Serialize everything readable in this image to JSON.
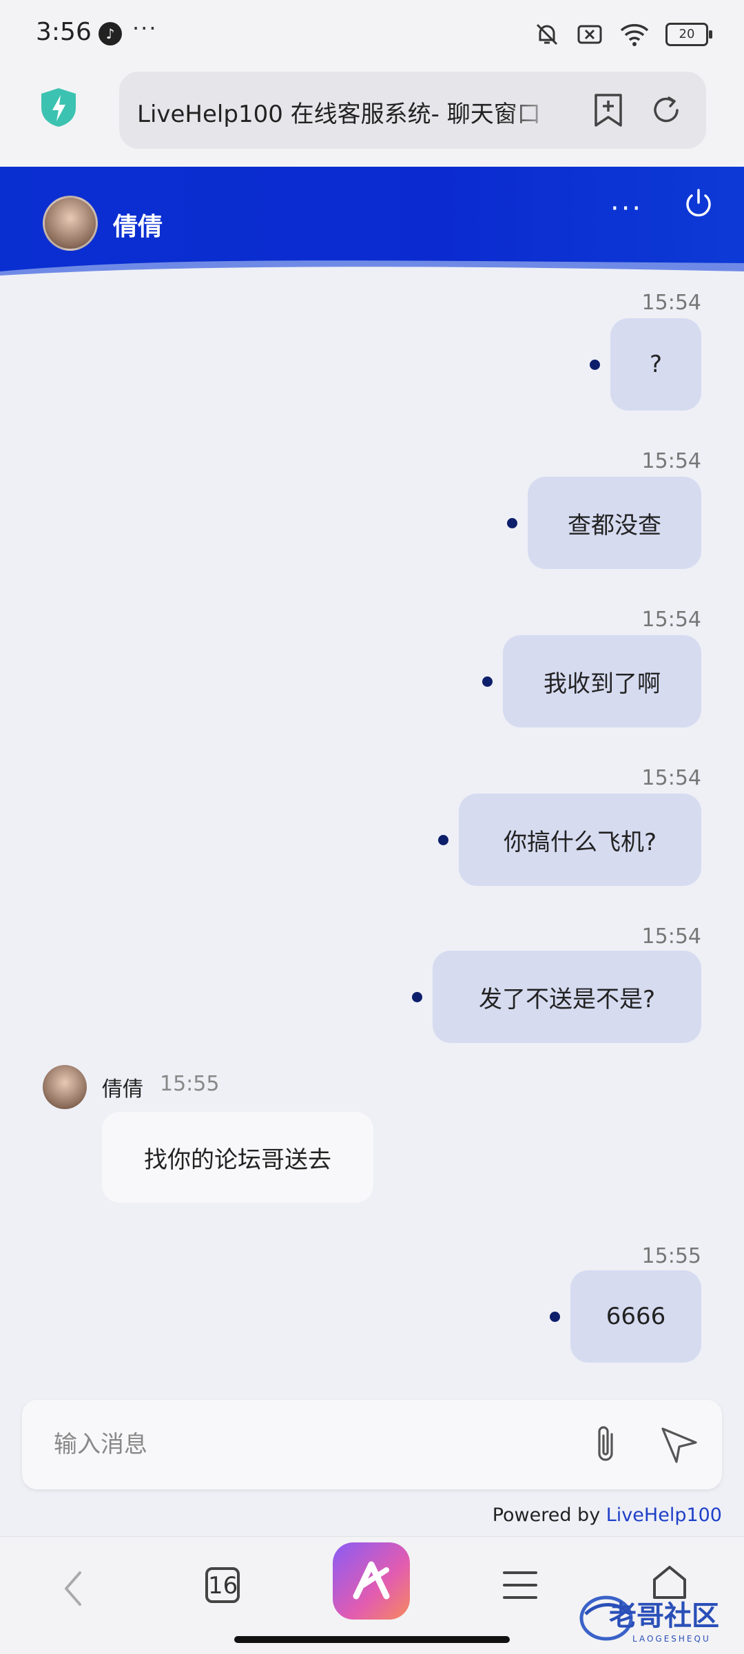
{
  "status_bar": {
    "time": "3:56",
    "battery": "20"
  },
  "browser": {
    "url_title": "LiveHelp100 在线客服系统- 聊天窗口",
    "tab_count": "16"
  },
  "chat": {
    "agent_name": "倩倩",
    "messages": [
      {
        "dir": "out",
        "time": "15:54",
        "text": "?"
      },
      {
        "dir": "out",
        "time": "15:54",
        "text": "查都没查"
      },
      {
        "dir": "out",
        "time": "15:54",
        "text": "我收到了啊"
      },
      {
        "dir": "out",
        "time": "15:54",
        "text": "你搞什么飞机?"
      },
      {
        "dir": "out",
        "time": "15:54",
        "text": "发了不送是不是?"
      },
      {
        "dir": "in",
        "name": "倩倩",
        "time": "15:55",
        "text": "找你的论坛哥送去"
      },
      {
        "dir": "out",
        "time": "15:55",
        "text": "6666"
      }
    ]
  },
  "input": {
    "placeholder": "输入消息"
  },
  "footer": {
    "powered_prefix": "Powered by ",
    "powered_brand": "LiveHelp100"
  },
  "watermark": {
    "text": "老哥社区",
    "sub": "LAOGESHEQU"
  },
  "colors": {
    "header": "#0a2fd1",
    "bubble_out": "#d6dbf0",
    "bubble_in": "#f8f8fa",
    "read_dot": "#0d1f6b",
    "link": "#1f3fc8"
  }
}
